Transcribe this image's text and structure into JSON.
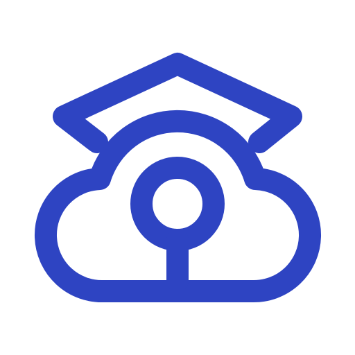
{
  "logo": {
    "icon": "cloud-graduation-cap-keyhole-icon",
    "color": "#2E44C2",
    "background": "#FFFFFF"
  }
}
